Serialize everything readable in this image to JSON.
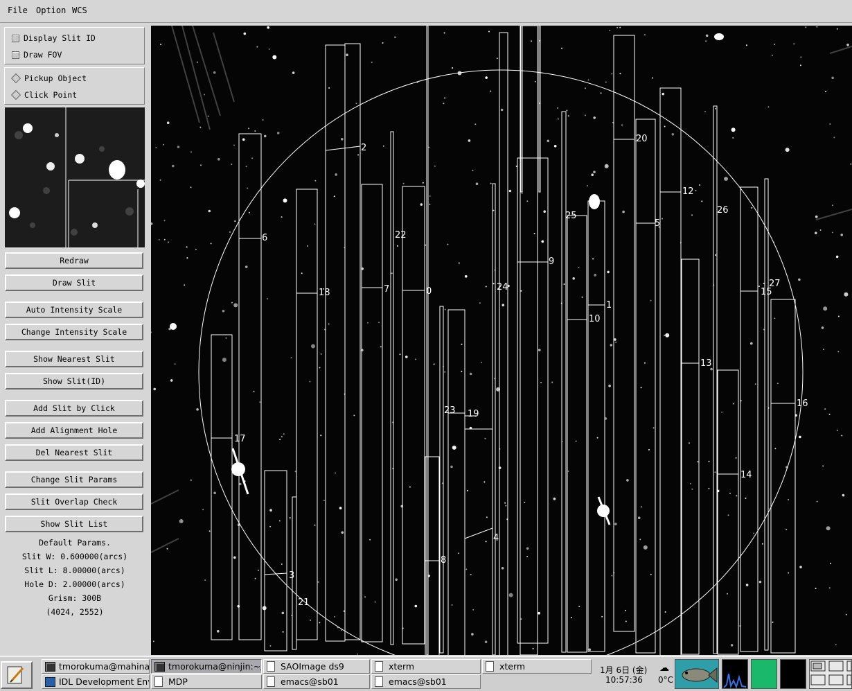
{
  "menubar": {
    "items": [
      "File",
      "Option",
      "WCS"
    ]
  },
  "options": {
    "display_slit_id": "Display Slit ID",
    "draw_fov": "Draw FOV",
    "pickup_object": "Pickup Object",
    "click_point": "Click Point"
  },
  "buttons": {
    "redraw": "Redraw",
    "draw_slit": "Draw Slit",
    "auto_intensity": "Auto Intensity Scale",
    "change_intensity": "Change Intensity Scale",
    "show_nearest": "Show Nearest Slit",
    "show_slit_id": "Show Slit(ID)",
    "add_slit_click": "Add Slit by Click",
    "add_alignment": "Add Alignment Hole",
    "del_nearest": "Del Nearest Slit",
    "change_params": "Change Slit Params",
    "overlap_check": "Slit Overlap Check",
    "show_list": "Show Slit List"
  },
  "params": {
    "heading": "Default Params.",
    "slit_w": "Slit W: 0.600000(arcs)",
    "slit_l": "Slit L: 8.00000(arcs)",
    "hole_d": "Hole D: 2.00000(arcs)",
    "grism": "Grism: 300B",
    "coords": "(4024, 2552)"
  },
  "slit_labels": [
    "2",
    "6",
    "22",
    "18",
    "7",
    "0",
    "24",
    "9",
    "25",
    "10",
    "1",
    "20",
    "12",
    "26",
    "5",
    "27",
    "15",
    "13",
    "16",
    "17",
    "23",
    "19",
    "14",
    "4",
    "8",
    "3",
    "21"
  ],
  "taskbar": {
    "tasks": [
      {
        "label": "tmorokuma@mahina:~",
        "icon": "terminal-icon"
      },
      {
        "label": "tmorokuma@ninjin:~/S",
        "icon": "terminal-icon"
      },
      {
        "label": "SAOImage ds9",
        "icon": "document-icon"
      },
      {
        "label": "xterm",
        "icon": "document-icon"
      },
      {
        "label": "xterm",
        "icon": "document-icon"
      },
      {
        "label": "IDL Development Envi",
        "icon": "idl-icon"
      },
      {
        "label": "MDP",
        "icon": "document-icon"
      },
      {
        "label": "emacs@sb01",
        "icon": "document-icon"
      },
      {
        "label": "emacs@sb01",
        "icon": "document-icon"
      }
    ],
    "date": "1月 6日 (金)",
    "time": "10:57:36",
    "temperature": "0°C"
  },
  "colors": {
    "panel_bg": "#d6d6d6",
    "image_bg": "#050505",
    "overlay": "#ffffff",
    "green_monitor": "#19b86a",
    "fish_bg": "#2f9ea8"
  }
}
